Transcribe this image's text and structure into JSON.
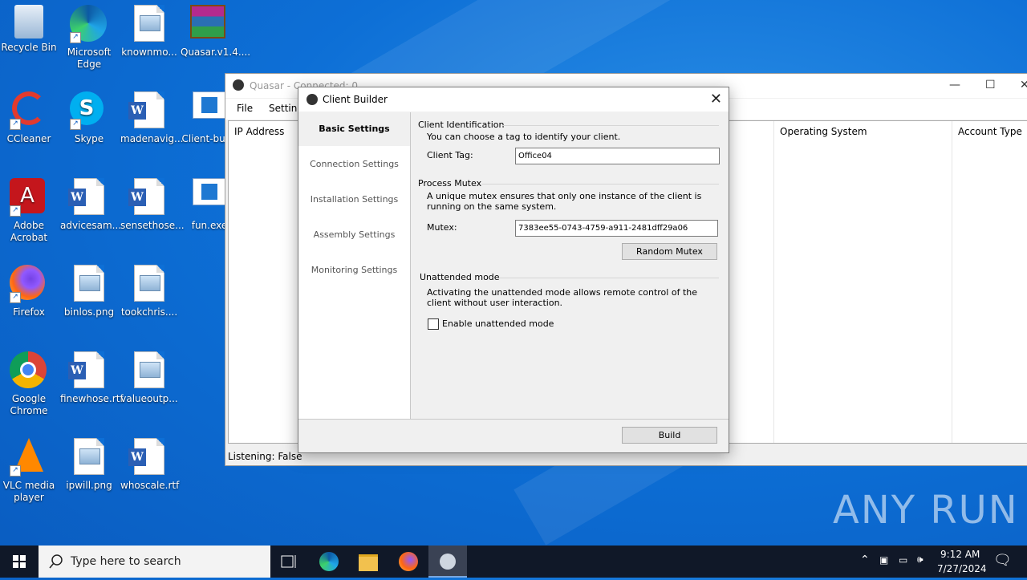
{
  "desktop": {
    "icons": [
      {
        "label": "Recycle Bin"
      },
      {
        "label": "Microsoft Edge"
      },
      {
        "label": "knownmo..."
      },
      {
        "label": "Quasar.v1.4...."
      },
      {
        "label": "CCleaner"
      },
      {
        "label": "Skype"
      },
      {
        "label": "madenavig..."
      },
      {
        "label": "Client-bui..."
      },
      {
        "label": "Adobe Acrobat"
      },
      {
        "label": "advicesam..."
      },
      {
        "label": "sensethose..."
      },
      {
        "label": "fun.exe"
      },
      {
        "label": "Firefox"
      },
      {
        "label": "binlos.png"
      },
      {
        "label": "tookchris...."
      },
      {
        "label": "Google Chrome"
      },
      {
        "label": "finewhose.rtf"
      },
      {
        "label": "valueoutp..."
      },
      {
        "label": "VLC media player"
      },
      {
        "label": "ipwill.png"
      },
      {
        "label": "whoscale.rtf"
      }
    ],
    "watermark": "ANY RUN"
  },
  "quasar": {
    "title": "Quasar - Connected: 0",
    "menu": {
      "file": "File",
      "settings": "Settings"
    },
    "columns": {
      "ip": "IP Address",
      "os": "Operating System",
      "account": "Account Type"
    },
    "status": "Listening: False"
  },
  "dialog": {
    "title": "Client Builder",
    "nav": [
      "Basic Settings",
      "Connection Settings",
      "Installation Settings",
      "Assembly Settings",
      "Monitoring Settings"
    ],
    "client_id": {
      "header": "Client Identification",
      "desc": "You can choose a tag to identify your client.",
      "tag_label": "Client Tag:",
      "tag_value": "Office04"
    },
    "mutex": {
      "header": "Process Mutex",
      "desc": "A unique mutex ensures that only one instance of the client is running on the same system.",
      "label": "Mutex:",
      "value": "7383ee55-0743-4759-a911-2481dff29a06",
      "random_button": "Random Mutex"
    },
    "unattended": {
      "header": "Unattended mode",
      "desc": "Activating the unattended mode allows remote control of the client without user interaction.",
      "checkbox_label": "Enable unattended mode",
      "checked": false
    },
    "build_button": "Build"
  },
  "taskbar": {
    "search_placeholder": "Type here to search",
    "time": "9:12 AM",
    "date": "7/27/2024"
  }
}
